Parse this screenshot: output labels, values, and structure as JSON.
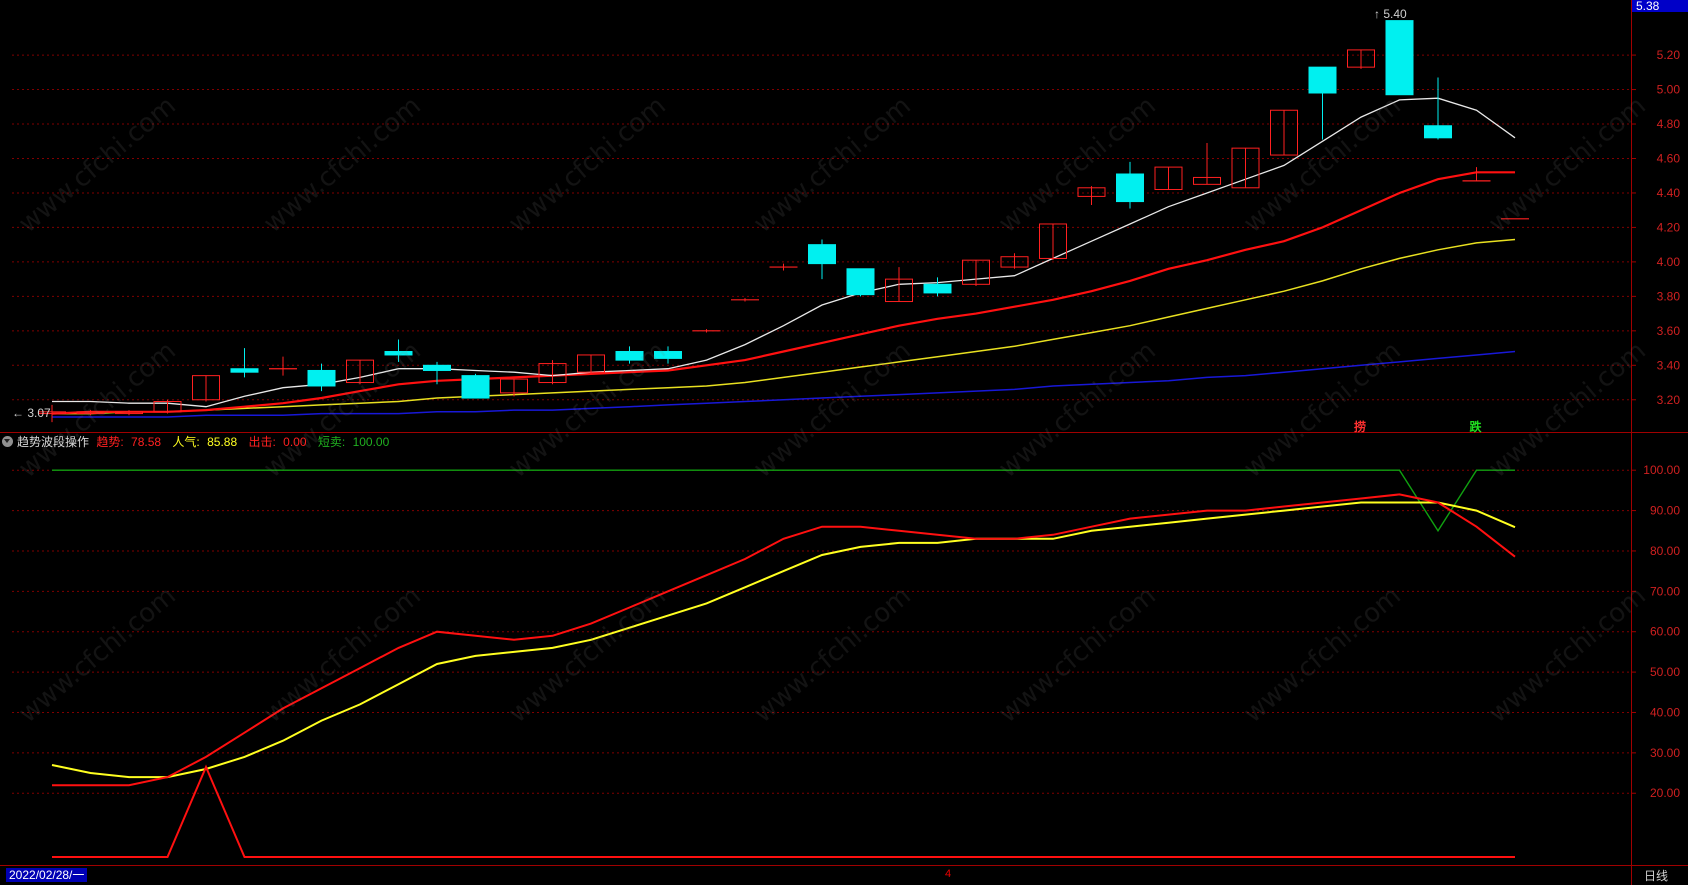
{
  "colors": {
    "background": "#000000",
    "up": "#ff2020",
    "down": "#00f0f0",
    "ma5": "#e8e8e8",
    "ma10": "#ff1010",
    "ma20": "#e8e020",
    "ma60": "#1818d8",
    "trend": "#ff1010",
    "popularity": "#ffff20",
    "exit": "#ff1010",
    "short_sell": "#10a010",
    "grid": "#800000"
  },
  "watermark_text": "www.cfchi.com",
  "price_axis": {
    "ticks": [
      "5.20",
      "5.00",
      "4.80",
      "4.60",
      "4.40",
      "4.20",
      "4.00",
      "3.80",
      "3.60",
      "3.40",
      "3.20"
    ],
    "current_price": "5.38",
    "range": [
      3.1,
      5.45
    ]
  },
  "indicator_axis": {
    "ticks": [
      "100.00",
      "90.00",
      "80.00",
      "70.00",
      "60.00",
      "50.00",
      "40.00",
      "30.00",
      "20.00"
    ],
    "range": [
      0,
      105
    ]
  },
  "high_label": "5.40",
  "low_label": "3.07",
  "indicator_header": {
    "name": "趋势波段操作",
    "trend_label": "趋势:",
    "trend_value": "78.58",
    "popularity_label": "人气:",
    "popularity_value": "85.88",
    "exit_label": "出击:",
    "exit_value": "0.00",
    "short_label": "短卖:",
    "short_value": "100.00"
  },
  "signals": [
    {
      "text": "捞",
      "color": "#ff3030",
      "bar_index": 34
    },
    {
      "text": "跌",
      "color": "#20e020",
      "bar_index": 37
    }
  ],
  "footer": {
    "date": "2022/02/28/一",
    "middle_marker": "4",
    "period": "日线"
  },
  "chart_data": {
    "type": "candlestick",
    "candles": [
      {
        "o": 3.12,
        "c": 3.13,
        "h": 3.17,
        "l": 3.07
      },
      {
        "o": 3.12,
        "c": 3.13,
        "h": 3.14,
        "l": 3.11
      },
      {
        "o": 3.12,
        "c": 3.13,
        "h": 3.14,
        "l": 3.11
      },
      {
        "o": 3.13,
        "c": 3.19,
        "h": 3.2,
        "l": 3.12
      },
      {
        "o": 3.2,
        "c": 3.34,
        "h": 3.34,
        "l": 3.19
      },
      {
        "o": 3.38,
        "c": 3.36,
        "h": 3.5,
        "l": 3.33
      },
      {
        "o": 3.38,
        "c": 3.38,
        "h": 3.45,
        "l": 3.34
      },
      {
        "o": 3.37,
        "c": 3.28,
        "h": 3.41,
        "l": 3.25
      },
      {
        "o": 3.3,
        "c": 3.43,
        "h": 3.43,
        "l": 3.29
      },
      {
        "o": 3.48,
        "c": 3.46,
        "h": 3.55,
        "l": 3.42
      },
      {
        "o": 3.4,
        "c": 3.37,
        "h": 3.42,
        "l": 3.29
      },
      {
        "o": 3.34,
        "c": 3.21,
        "h": 3.35,
        "l": 3.21
      },
      {
        "o": 3.24,
        "c": 3.32,
        "h": 3.32,
        "l": 3.22
      },
      {
        "o": 3.3,
        "c": 3.41,
        "h": 3.43,
        "l": 3.29
      },
      {
        "o": 3.36,
        "c": 3.46,
        "h": 3.46,
        "l": 3.35
      },
      {
        "o": 3.48,
        "c": 3.43,
        "h": 3.51,
        "l": 3.41
      },
      {
        "o": 3.48,
        "c": 3.44,
        "h": 3.51,
        "l": 3.41
      },
      {
        "o": 3.6,
        "c": 3.6,
        "h": 3.61,
        "l": 3.59
      },
      {
        "o": 3.78,
        "c": 3.78,
        "h": 3.79,
        "l": 3.77
      },
      {
        "o": 3.97,
        "c": 3.97,
        "h": 3.99,
        "l": 3.95
      },
      {
        "o": 4.1,
        "c": 3.99,
        "h": 4.13,
        "l": 3.9
      },
      {
        "o": 3.96,
        "c": 3.81,
        "h": 3.96,
        "l": 3.8
      },
      {
        "o": 3.77,
        "c": 3.9,
        "h": 3.97,
        "l": 3.77
      },
      {
        "o": 3.87,
        "c": 3.82,
        "h": 3.91,
        "l": 3.8
      },
      {
        "o": 3.87,
        "c": 4.01,
        "h": 4.01,
        "l": 3.86
      },
      {
        "o": 3.97,
        "c": 4.03,
        "h": 4.05,
        "l": 3.96
      },
      {
        "o": 4.02,
        "c": 4.22,
        "h": 4.22,
        "l": 4.01
      },
      {
        "o": 4.38,
        "c": 4.43,
        "h": 4.44,
        "l": 4.33
      },
      {
        "o": 4.51,
        "c": 4.35,
        "h": 4.58,
        "l": 4.31
      },
      {
        "o": 4.42,
        "c": 4.55,
        "h": 4.55,
        "l": 4.42
      },
      {
        "o": 4.45,
        "c": 4.49,
        "h": 4.69,
        "l": 4.45
      },
      {
        "o": 4.43,
        "c": 4.66,
        "h": 4.66,
        "l": 4.43
      },
      {
        "o": 4.62,
        "c": 4.88,
        "h": 4.88,
        "l": 4.62
      },
      {
        "o": 5.13,
        "c": 4.98,
        "h": 5.13,
        "l": 4.71
      },
      {
        "o": 5.13,
        "c": 5.23,
        "h": 5.23,
        "l": 5.12
      },
      {
        "o": 5.4,
        "c": 4.97,
        "h": 5.4,
        "l": 4.97
      },
      {
        "o": 4.79,
        "c": 4.72,
        "h": 5.07,
        "l": 4.71
      },
      {
        "o": 4.47,
        "c": 4.47,
        "h": 4.55,
        "l": 4.47
      },
      {
        "o": 4.25,
        "c": 4.25,
        "h": 4.25,
        "l": 4.25
      }
    ],
    "ma5": [
      3.19,
      3.19,
      3.18,
      3.18,
      3.16,
      3.22,
      3.27,
      3.29,
      3.33,
      3.38,
      3.38,
      3.37,
      3.36,
      3.34,
      3.36,
      3.37,
      3.38,
      3.43,
      3.52,
      3.63,
      3.75,
      3.82,
      3.87,
      3.88,
      3.9,
      3.92,
      4.02,
      4.12,
      4.22,
      4.32,
      4.4,
      4.48,
      4.56,
      4.7,
      4.84,
      4.94,
      4.95,
      4.88,
      4.72
    ],
    "ma10": [
      3.12,
      3.13,
      3.13,
      3.13,
      3.14,
      3.16,
      3.18,
      3.21,
      3.25,
      3.29,
      3.31,
      3.32,
      3.33,
      3.34,
      3.35,
      3.36,
      3.37,
      3.4,
      3.43,
      3.48,
      3.53,
      3.58,
      3.63,
      3.67,
      3.7,
      3.74,
      3.78,
      3.83,
      3.89,
      3.96,
      4.01,
      4.07,
      4.12,
      4.2,
      4.3,
      4.4,
      4.48,
      4.52,
      4.52
    ],
    "ma20": [
      3.12,
      3.12,
      3.13,
      3.13,
      3.14,
      3.15,
      3.16,
      3.17,
      3.18,
      3.19,
      3.21,
      3.22,
      3.23,
      3.24,
      3.25,
      3.26,
      3.27,
      3.28,
      3.3,
      3.33,
      3.36,
      3.39,
      3.42,
      3.45,
      3.48,
      3.51,
      3.55,
      3.59,
      3.63,
      3.68,
      3.73,
      3.78,
      3.83,
      3.89,
      3.96,
      4.02,
      4.07,
      4.11,
      4.13
    ],
    "ma60": [
      3.1,
      3.1,
      3.1,
      3.1,
      3.11,
      3.11,
      3.11,
      3.12,
      3.12,
      3.12,
      3.13,
      3.13,
      3.14,
      3.14,
      3.15,
      3.16,
      3.17,
      3.18,
      3.19,
      3.2,
      3.21,
      3.22,
      3.23,
      3.24,
      3.25,
      3.26,
      3.28,
      3.29,
      3.3,
      3.31,
      3.33,
      3.34,
      3.36,
      3.38,
      3.4,
      3.42,
      3.44,
      3.46,
      3.48
    ],
    "trend": [
      22,
      22,
      22,
      24,
      29,
      35,
      41,
      46,
      51,
      56,
      60,
      59,
      58,
      59,
      62,
      66,
      70,
      74,
      78,
      83,
      86,
      86,
      85,
      84,
      83,
      83,
      84,
      86,
      88,
      89,
      90,
      90,
      91,
      92,
      93,
      94,
      92,
      86,
      78.58
    ],
    "popularity": [
      27,
      25,
      24,
      24,
      26,
      29,
      33,
      38,
      42,
      47,
      52,
      54,
      55,
      56,
      58,
      61,
      64,
      67,
      71,
      75,
      79,
      81,
      82,
      82,
      83,
      83,
      83,
      85,
      86,
      87,
      88,
      89,
      90,
      91,
      92,
      92,
      92,
      90,
      85.88
    ],
    "short_sell": [
      100,
      100,
      100,
      100,
      100,
      100,
      100,
      100,
      100,
      100,
      100,
      100,
      100,
      100,
      100,
      100,
      100,
      100,
      100,
      100,
      100,
      100,
      100,
      100,
      100,
      100,
      100,
      100,
      100,
      100,
      100,
      100,
      100,
      100,
      100,
      100,
      85,
      100,
      100
    ],
    "exit": [
      0,
      0,
      0,
      0,
      20,
      0,
      0,
      0,
      0,
      0,
      0,
      0,
      0,
      0,
      0,
      0,
      0,
      0,
      0,
      0,
      0,
      0,
      0,
      0,
      0,
      0,
      0,
      0,
      0,
      0,
      0,
      0,
      0,
      0,
      0,
      0,
      0,
      0,
      0
    ]
  }
}
